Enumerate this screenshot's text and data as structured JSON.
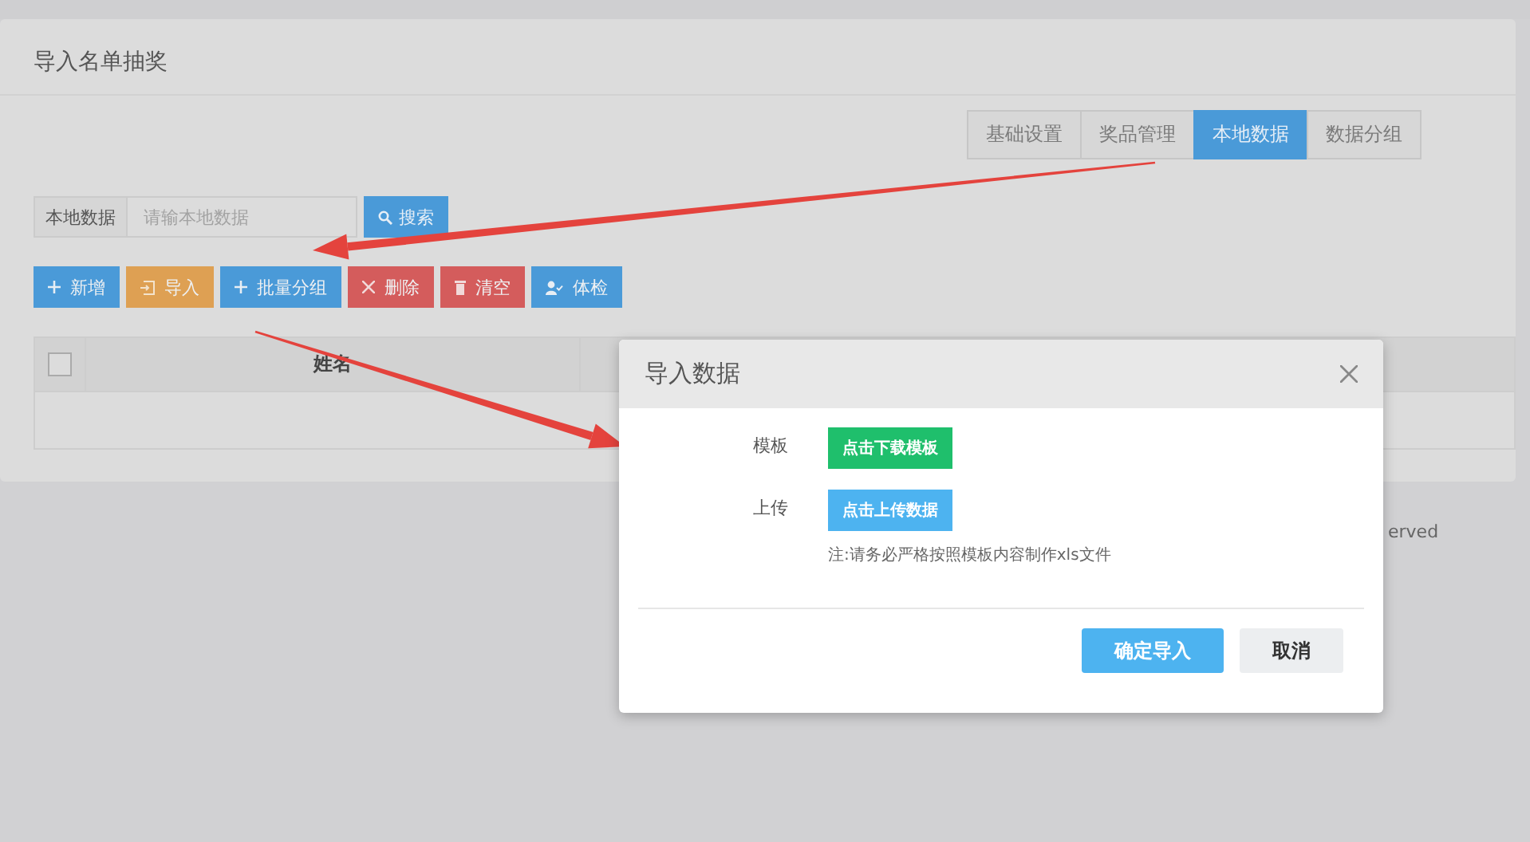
{
  "page": {
    "title": "导入名单抽奖"
  },
  "tabs": [
    {
      "label": "基础设置",
      "selected": false
    },
    {
      "label": "奖品管理",
      "selected": false
    },
    {
      "label": "本地数据",
      "selected": true
    },
    {
      "label": "数据分组",
      "selected": false
    }
  ],
  "search": {
    "addon": "本地数据",
    "placeholder": "请输本地数据",
    "button": "搜索"
  },
  "toolbar": [
    {
      "kind": "add",
      "label": "新增"
    },
    {
      "kind": "import",
      "label": "导入"
    },
    {
      "kind": "add",
      "label": "批量分组"
    },
    {
      "kind": "delete",
      "label": "删除"
    },
    {
      "kind": "clear",
      "label": "清空"
    },
    {
      "kind": "check",
      "label": "体检"
    }
  ],
  "table": {
    "select_all": {
      "checked": false
    },
    "columns": [
      "姓名"
    ]
  },
  "footer": {
    "text": "erved"
  },
  "dialog": {
    "title": "导入数据",
    "rows": [
      {
        "label": "模板",
        "button": "点击下载模板",
        "kind": "download"
      },
      {
        "label": "上传",
        "button": "点击上传数据",
        "kind": "upload",
        "note": "注:请务必严格按照模板内容制作xls文件"
      }
    ],
    "buttons": [
      {
        "kind": "primary",
        "label": "确定导入"
      },
      {
        "kind": "default",
        "label": "取消"
      }
    ]
  }
}
